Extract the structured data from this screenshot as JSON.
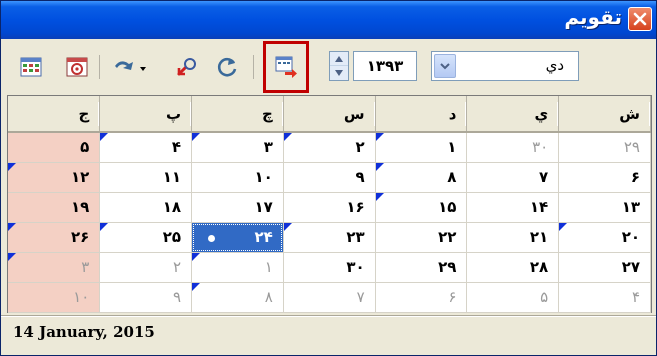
{
  "window": {
    "title": "تقويم"
  },
  "toolbar": {
    "buttons": [
      {
        "icon": "calendar-grid-icon"
      },
      {
        "icon": "calendar-settings-icon"
      },
      {
        "icon": "color-picker-icon"
      },
      {
        "icon": "undo-icon"
      },
      {
        "icon": "refresh-icon"
      },
      {
        "icon": "go-to-today-icon"
      }
    ],
    "year_value": "۱۳۹۳",
    "month_value": "دي"
  },
  "grid": {
    "headers": [
      "ش",
      "ي",
      "د",
      "س",
      "چ",
      "پ",
      "ج"
    ],
    "rows": [
      [
        {
          "t": "۲۹",
          "dim": true
        },
        {
          "t": "۳۰",
          "dim": true
        },
        {
          "t": "۱",
          "note": true
        },
        {
          "t": "۲",
          "note": true
        },
        {
          "t": "۳",
          "note": true
        },
        {
          "t": "۴",
          "note": true
        },
        {
          "t": "۵",
          "friday": true
        }
      ],
      [
        {
          "t": "۶"
        },
        {
          "t": "۷"
        },
        {
          "t": "۸",
          "note": true
        },
        {
          "t": "۹"
        },
        {
          "t": "۱۰"
        },
        {
          "t": "۱۱"
        },
        {
          "t": "۱۲",
          "friday": true,
          "note": true
        }
      ],
      [
        {
          "t": "۱۳"
        },
        {
          "t": "۱۴"
        },
        {
          "t": "۱۵",
          "note": true
        },
        {
          "t": "۱۶"
        },
        {
          "t": "۱۷"
        },
        {
          "t": "۱۸"
        },
        {
          "t": "۱۹",
          "friday": true
        }
      ],
      [
        {
          "t": "۲۰",
          "note": true
        },
        {
          "t": "۲۱"
        },
        {
          "t": "۲۲"
        },
        {
          "t": "۲۳",
          "note": true
        },
        {
          "t": "۲۴",
          "selected": true
        },
        {
          "t": "۲۵",
          "note": true
        },
        {
          "t": "۲۶",
          "friday": true,
          "note": true
        }
      ],
      [
        {
          "t": "۲۷"
        },
        {
          "t": "۲۸"
        },
        {
          "t": "۲۹"
        },
        {
          "t": "۳۰"
        },
        {
          "t": "۱",
          "dim": true,
          "note": true
        },
        {
          "t": "۲",
          "dim": true
        },
        {
          "t": "۳",
          "dim": true,
          "friday": true,
          "note": true
        }
      ],
      [
        {
          "t": "۴",
          "dim": true
        },
        {
          "t": "۵",
          "dim": true
        },
        {
          "t": "۶",
          "dim": true
        },
        {
          "t": "۷",
          "dim": true
        },
        {
          "t": "۸",
          "dim": true,
          "note": true
        },
        {
          "t": "۹",
          "dim": true
        },
        {
          "t": "۱۰",
          "dim": true,
          "friday": true
        }
      ]
    ]
  },
  "status": {
    "date_text": "14 January, 2015"
  },
  "colors": {
    "titlebar": "#0050e0",
    "friday_bg": "#f4d0c4",
    "selected_bg": "#316ac5",
    "note_marker": "#1030d8",
    "highlight_box": "#c00000"
  }
}
